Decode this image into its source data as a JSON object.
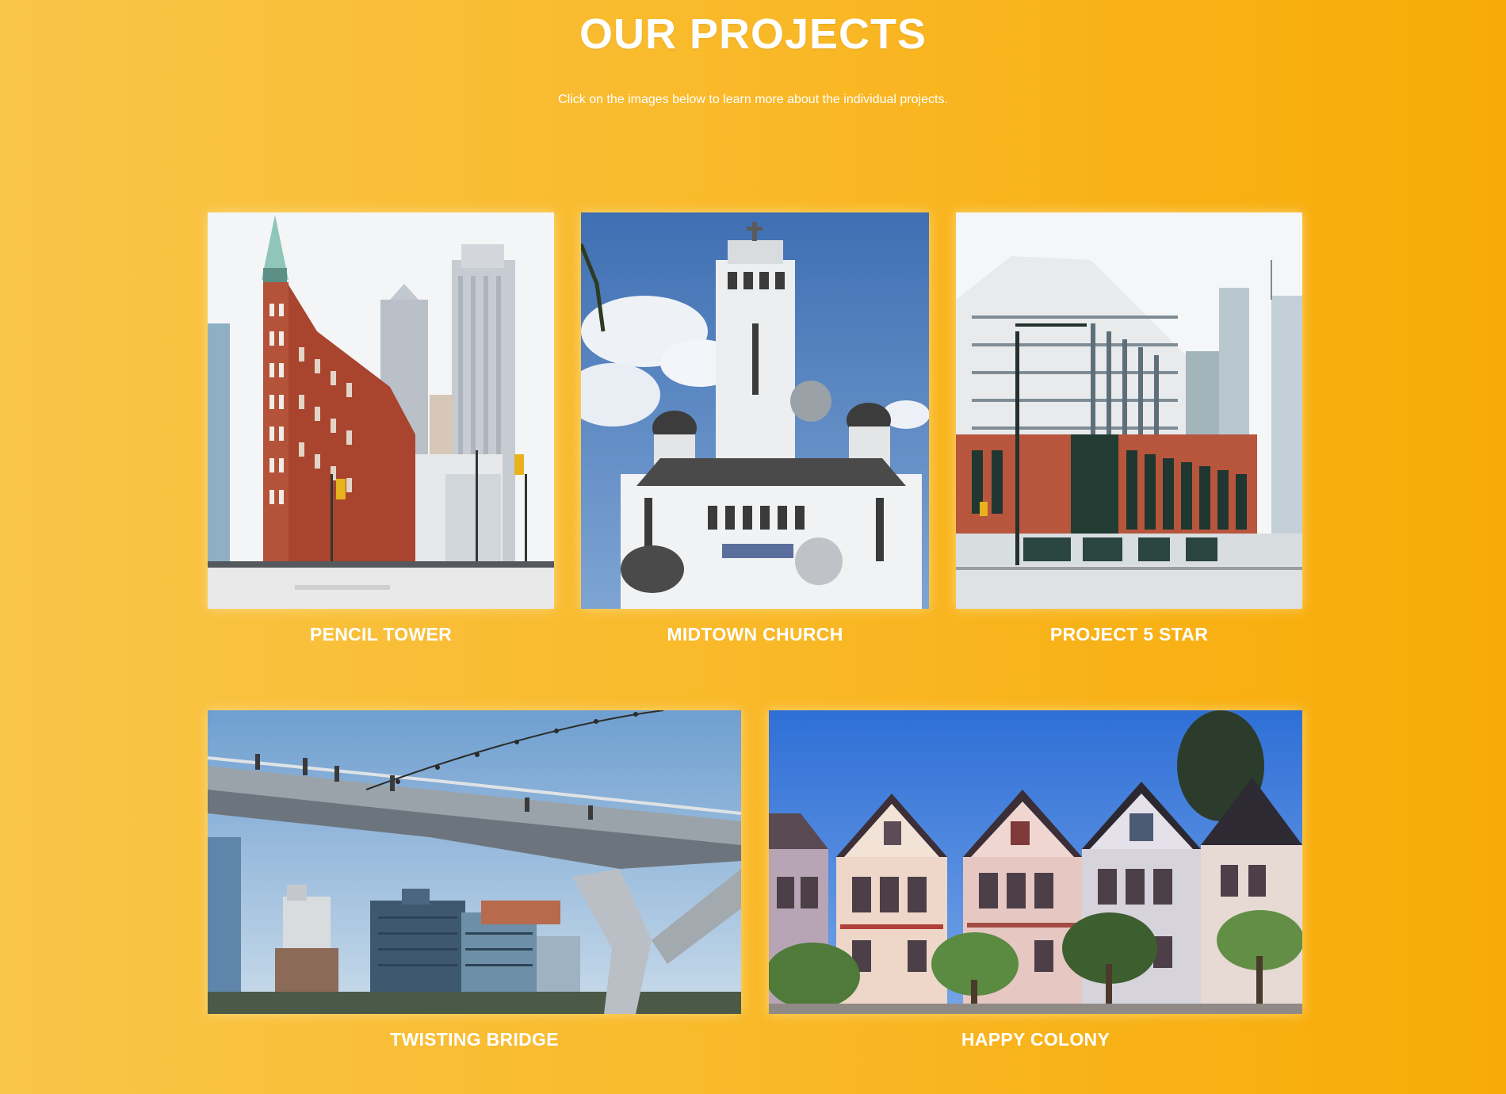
{
  "header": {
    "title": "OUR PROJECTS",
    "subtitle": "Click on the images below to learn more about the individual projects."
  },
  "projects": [
    {
      "name": "PENCIL TOWER",
      "image": "flatiron-building-photo"
    },
    {
      "name": "MIDTOWN CHURCH",
      "image": "church-tower-photo"
    },
    {
      "name": "PROJECT 5 STAR",
      "image": "modern-building-photo"
    },
    {
      "name": "TWISTING BRIDGE",
      "image": "footbridge-photo"
    },
    {
      "name": "HAPPY COLONY",
      "image": "row-houses-photo"
    }
  ],
  "colors": {
    "background_left": "#f9c548",
    "background_right": "#f8ab06",
    "text": "#ffffff"
  }
}
